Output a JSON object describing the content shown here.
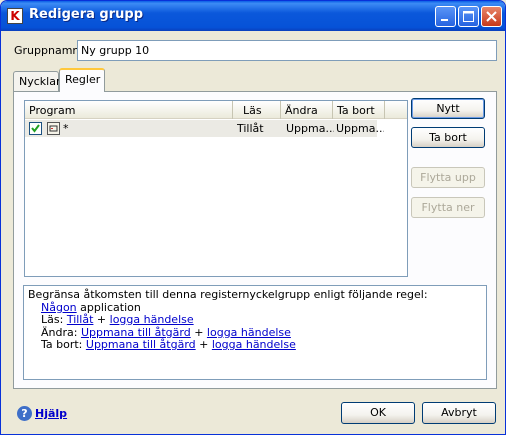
{
  "window": {
    "title": "Redigera grupp",
    "app_icon_letter": "K"
  },
  "group_name": {
    "label": "Gruppnamn:",
    "value": "Ny grupp 10"
  },
  "tabs": [
    {
      "label": "Nycklar",
      "active": false
    },
    {
      "label": "Regler",
      "active": true
    }
  ],
  "list": {
    "columns": [
      "Program",
      "Läs",
      "Ändra",
      "Ta bort"
    ],
    "rows": [
      {
        "checked": true,
        "program": "*",
        "las": "Tillåt",
        "andra": "Uppma...",
        "ta_bort": "Uppma..."
      }
    ]
  },
  "side_buttons": {
    "new": "Nytt",
    "delete": "Ta bort",
    "move_up": "Flytta upp",
    "move_down": "Flytta ner"
  },
  "description": {
    "intro": "Begränsa åtkomsten till denna registernyckelgrupp enligt följande regel:",
    "app_link": "Någon",
    "app_text": " application",
    "las_label": "Läs: ",
    "las_link1": "Tillåt",
    "plus": " + ",
    "log_link": "logga händelse",
    "andra_label": "Ändra: ",
    "andra_link": "Uppmana till åtgärd",
    "tabort_label": "Ta bort: ",
    "tabort_link": "Uppmana till åtgärd"
  },
  "footer": {
    "help": "Hjälp",
    "ok": "OK",
    "cancel": "Avbryt"
  },
  "colors": {
    "titlebar": "#0652D7",
    "link": "#0000CC",
    "active_tab_accent": "#FFC83C"
  }
}
